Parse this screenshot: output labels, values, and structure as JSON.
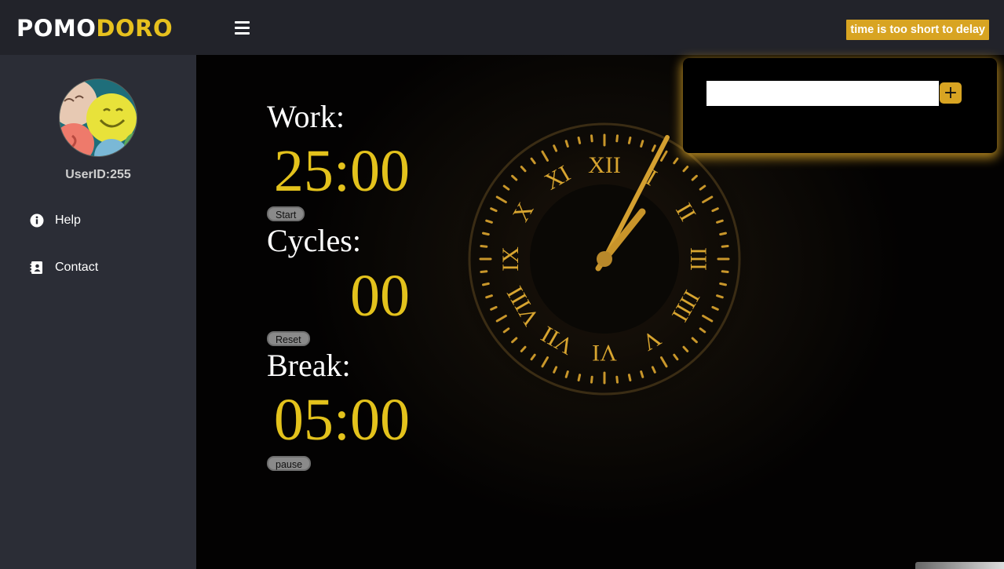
{
  "header": {
    "logo_part1": "POMO",
    "logo_part2": "DORO",
    "tagline": "time is too short to delay"
  },
  "sidebar": {
    "user_id": "UserID:255",
    "items": [
      {
        "label": "Help",
        "icon": "info-icon"
      },
      {
        "label": "Contact",
        "icon": "contact-book-icon"
      }
    ]
  },
  "timers": {
    "work_label": "Work:",
    "work_value": "25:00",
    "start_label": "Start",
    "cycles_label": "Cycles:",
    "cycles_value": "00",
    "reset_label": "Reset",
    "break_label": "Break:",
    "break_value": "05:00",
    "pause_label": "pause"
  },
  "todo": {
    "input_value": "",
    "add_symbol": "+"
  },
  "colors": {
    "accent": "#e3c21c",
    "tag_bg": "#d8a422",
    "sidebar_bg": "#2b2d36",
    "topbar_bg": "#22232a"
  }
}
